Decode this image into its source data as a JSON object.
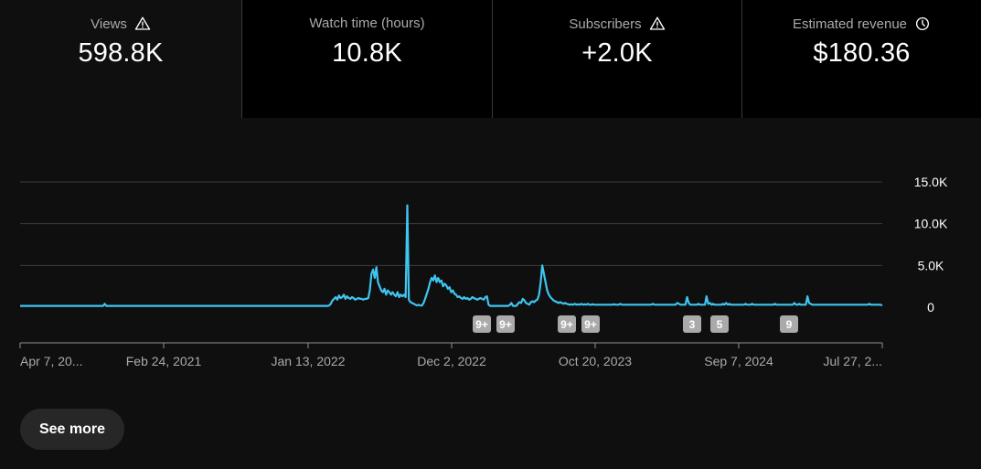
{
  "metrics": [
    {
      "label": "Views",
      "value": "598.8K",
      "icon": "warning-icon"
    },
    {
      "label": "Watch time (hours)",
      "value": "10.8K",
      "icon": ""
    },
    {
      "label": "Subscribers",
      "value": "+2.0K",
      "icon": "warning-icon"
    },
    {
      "label": "Estimated revenue",
      "value": "$180.36",
      "icon": "clock-icon"
    }
  ],
  "colors": {
    "line": "#3ec5f0",
    "background": "#0f0f0f",
    "card": "#000000",
    "marker": "#aaaaaa"
  },
  "chart_data": {
    "type": "line",
    "xlabel": "",
    "ylabel": "",
    "y_ticks": [
      "15.0K",
      "10.0K",
      "5.0K",
      "0"
    ],
    "y_tick_values": [
      15000,
      10000,
      5000,
      0
    ],
    "ylim": [
      0,
      15000
    ],
    "x_tick_labels": [
      "Apr 7, 20...",
      "Feb 24, 2021",
      "Jan 13, 2022",
      "Dec 2, 2022",
      "Oct 20, 2023",
      "Sep 7, 2024",
      "Jul 27, 2..."
    ],
    "grid": true,
    "series": [
      {
        "values": [
          150,
          150,
          150,
          150,
          150,
          150,
          150,
          150,
          150,
          150,
          150,
          150,
          150,
          150,
          150,
          150,
          150,
          150,
          150,
          150,
          150,
          150,
          150,
          150,
          150,
          150,
          150,
          150,
          150,
          150,
          150,
          150,
          150,
          150,
          150,
          150,
          150,
          150,
          150,
          150,
          150,
          150,
          150,
          150,
          150,
          150,
          150,
          150,
          150,
          150,
          150,
          150,
          400,
          150,
          150,
          150,
          150,
          150,
          150,
          150,
          150,
          150,
          150,
          150,
          150,
          150,
          150,
          150,
          150,
          150,
          150,
          150,
          150,
          150,
          150,
          150,
          150,
          150,
          150,
          150,
          150,
          150,
          150,
          150,
          150,
          150,
          150,
          150,
          150,
          150,
          150,
          150,
          150,
          150,
          150,
          150,
          150,
          150,
          150,
          150,
          150,
          150,
          150,
          150,
          150,
          150,
          150,
          150,
          150,
          150,
          150,
          150,
          150,
          150,
          150,
          150,
          150,
          150,
          150,
          150,
          150,
          150,
          150,
          150,
          150,
          150,
          150,
          150,
          150,
          150,
          150,
          150,
          150,
          150,
          150,
          150,
          150,
          150,
          150,
          150,
          150,
          150,
          150,
          150,
          150,
          150,
          150,
          150,
          150,
          150,
          150,
          150,
          150,
          150,
          150,
          150,
          150,
          150,
          150,
          150,
          150,
          150,
          150,
          150,
          150,
          150,
          150,
          150,
          150,
          150,
          150,
          150,
          150,
          150,
          150,
          150,
          150,
          150,
          150,
          150,
          150,
          150,
          150,
          150,
          150,
          150,
          150,
          150,
          150,
          150,
          200,
          400,
          800,
          1000,
          1200,
          900,
          1400,
          1100,
          1200,
          1500,
          1000,
          1300,
          1100,
          1000,
          1200,
          1100,
          900,
          1000,
          1100,
          1000,
          1000,
          900,
          1000,
          1000,
          1100,
          2000,
          4000,
          4500,
          3500,
          4800,
          3000,
          2500,
          2000,
          1800,
          2200,
          1500,
          2000,
          1800,
          1500,
          1800,
          1500,
          1300,
          1800,
          1200,
          1500,
          1300,
          1500,
          1200,
          12200,
          900,
          600,
          500,
          400,
          300,
          200,
          300,
          200,
          200,
          500,
          1000,
          1600,
          2200,
          3000,
          3500,
          3200,
          3800,
          3000,
          3500,
          3000,
          3200,
          2500,
          2800,
          2600,
          2200,
          2400,
          1800,
          2000,
          1600,
          1500,
          1200,
          1300,
          1100,
          1000,
          1200,
          1000,
          1100,
          900,
          1000,
          1200,
          1100,
          1000,
          900,
          1000,
          1100,
          1000,
          900,
          1200,
          1300,
          300,
          150,
          150,
          150,
          150,
          150,
          150,
          150,
          150,
          150,
          150,
          150,
          150,
          250,
          500,
          150,
          150,
          150,
          400,
          600,
          500,
          1000,
          800,
          500,
          400,
          300,
          600,
          700,
          600,
          800,
          900,
          1500,
          3000,
          5000,
          4000,
          3000,
          2000,
          1500,
          1200,
          1000,
          800,
          700,
          600,
          500,
          600,
          500,
          400,
          500,
          400,
          350,
          300,
          350,
          300,
          400,
          300,
          350,
          300,
          400,
          300,
          350,
          300,
          400,
          300,
          300,
          350,
          300,
          300,
          300,
          300,
          300,
          300,
          300,
          300,
          300,
          300,
          300,
          300,
          350,
          300,
          300,
          300,
          400,
          300,
          300,
          300,
          300,
          300,
          300,
          300,
          300,
          300,
          300,
          300,
          300,
          300,
          300,
          300,
          300,
          300,
          300,
          300,
          400,
          300,
          300,
          300,
          300,
          300,
          300,
          300,
          300,
          300,
          300,
          300,
          300,
          300,
          300,
          500,
          400,
          300,
          300,
          300,
          300,
          1200,
          500,
          300,
          300,
          300,
          300,
          300,
          400,
          300,
          300,
          300,
          300,
          1300,
          400,
          500,
          300,
          400,
          300,
          300,
          300,
          300,
          300,
          400,
          300,
          500,
          300,
          400,
          300,
          300,
          300,
          300,
          300,
          300,
          300,
          300,
          300,
          400,
          300,
          300,
          300,
          400,
          300,
          300,
          300,
          300,
          300,
          300,
          300,
          300,
          300,
          300,
          300,
          300,
          300,
          400,
          300,
          300,
          300,
          300,
          300,
          300,
          300,
          300,
          300,
          300,
          300,
          500,
          300,
          300,
          400,
          300,
          300,
          300,
          300,
          1300,
          500,
          400,
          300,
          300,
          300,
          300,
          300,
          300,
          300,
          300,
          300,
          300,
          300,
          300,
          300,
          300,
          300,
          300,
          300,
          300,
          300,
          300,
          300,
          300,
          300,
          300,
          300,
          300,
          300,
          300,
          300,
          300,
          300,
          300,
          300,
          300,
          300,
          400,
          300,
          300,
          300,
          300,
          300,
          300,
          300,
          200
        ]
      }
    ],
    "markers": [
      "9+",
      "9+",
      "9+",
      "9+",
      "3",
      "5",
      "9"
    ]
  },
  "see_more": "See more"
}
